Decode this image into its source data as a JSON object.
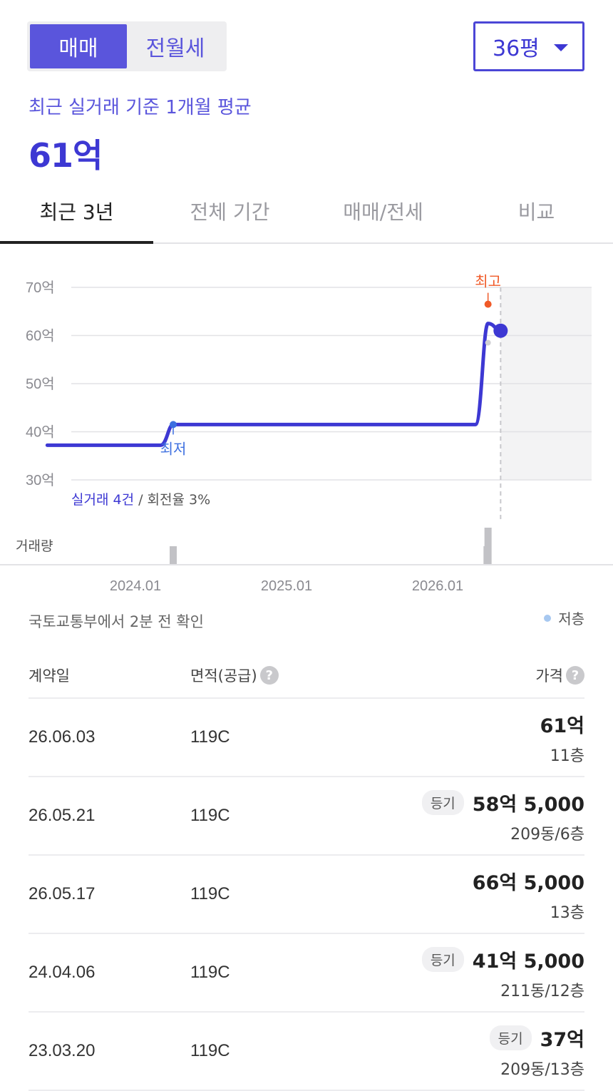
{
  "trade_type": {
    "sale_label": "매매",
    "rent_label": "전월세",
    "selected": "sale"
  },
  "size_select": {
    "value": "36평"
  },
  "summary": {
    "label": "최근 실거래 기준 1개월 평균",
    "value": "61억"
  },
  "tabs": [
    {
      "label": "최근 3년",
      "active": true
    },
    {
      "label": "전체 기간",
      "active": false
    },
    {
      "label": "매매/전세",
      "active": false
    },
    {
      "label": "비교",
      "active": false
    }
  ],
  "chart": {
    "stats_count": "실거래 4건",
    "stats_rate": " / 회전율 3%",
    "volume_label": "거래량",
    "low_label": "최저",
    "high_label": "최고"
  },
  "chart_data": {
    "type": "line",
    "y_unit": "억",
    "yticks": [
      "70억",
      "60억",
      "50억",
      "40억",
      "30억"
    ],
    "ylim": [
      30,
      70
    ],
    "xticks": [
      "2024.01",
      "2025.01",
      "2026.01"
    ],
    "series": [
      {
        "points": [
          [
            "2023.06",
            37.2
          ],
          [
            "2024.03",
            37.2
          ],
          [
            "2024.04",
            41.5
          ],
          [
            "2026.04",
            41.5
          ],
          [
            "2026.05",
            62.5
          ],
          [
            "2026.06",
            61
          ]
        ]
      }
    ],
    "volume": [
      [
        "2024.04",
        1
      ],
      [
        "2026.05",
        2
      ],
      [
        "2026.06",
        1
      ]
    ],
    "markers": {
      "low": [
        "2024.04",
        41.5
      ],
      "high": [
        "2026.05",
        66.5
      ],
      "current": [
        "2026.06",
        61
      ]
    },
    "colors": {
      "line": "#3d38d3",
      "low": "#3d6fe0",
      "high": "#f05a28",
      "volume": "#c2c2c6"
    }
  },
  "source": {
    "text": "국토교통부에서 2분 전 확인"
  },
  "legend": {
    "low_floor": "저층"
  },
  "table": {
    "headers": {
      "date": "계약일",
      "area": "면적(공급)",
      "price": "가격"
    },
    "rows": [
      {
        "date": "26.06.03",
        "area": "119C",
        "badge": "",
        "price": "61억",
        "floor": "11층"
      },
      {
        "date": "26.05.21",
        "area": "119C",
        "badge": "등기",
        "price": "58억 5,000",
        "floor": "209동/6층"
      },
      {
        "date": "26.05.17",
        "area": "119C",
        "badge": "",
        "price": "66억 5,000",
        "floor": "13층"
      },
      {
        "date": "24.04.06",
        "area": "119C",
        "badge": "등기",
        "price": "41억 5,000",
        "floor": "211동/12층"
      },
      {
        "date": "23.03.20",
        "area": "119C",
        "badge": "등기",
        "price": "37억",
        "floor": "209동/13층"
      }
    ]
  }
}
